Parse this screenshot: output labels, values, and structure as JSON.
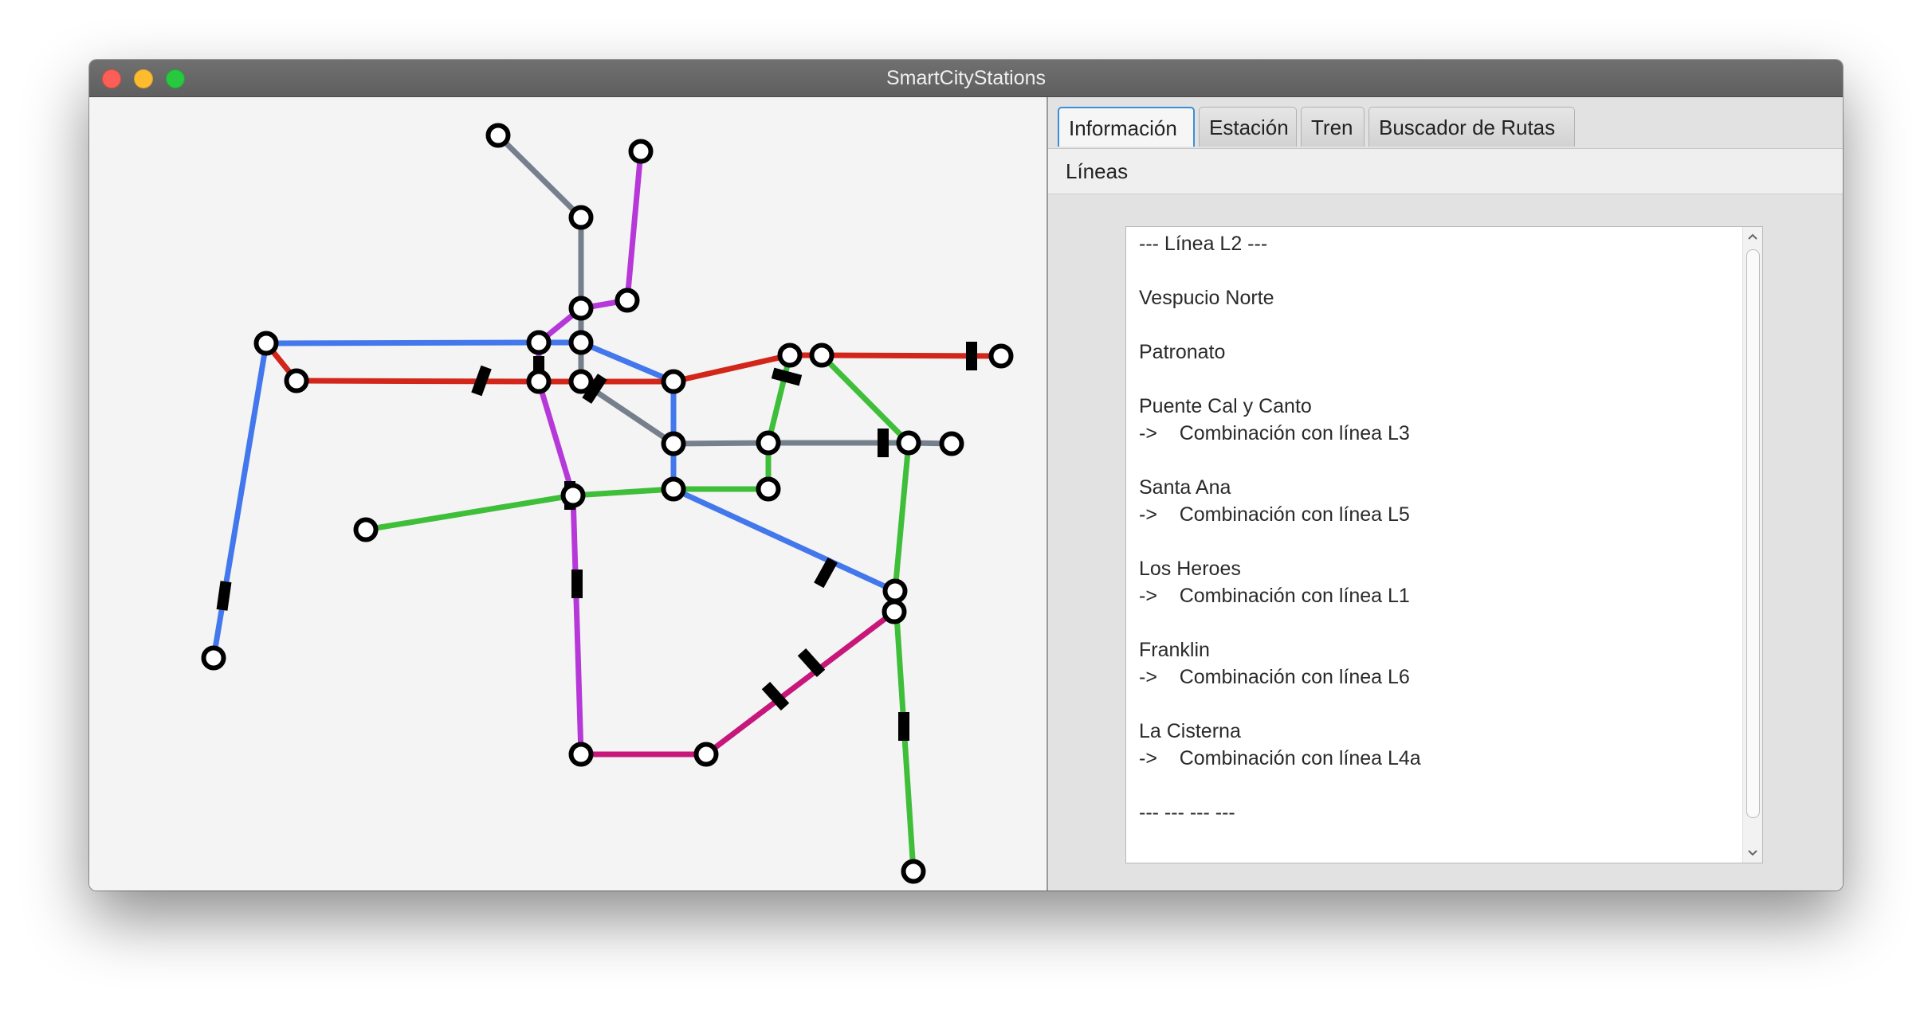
{
  "window": {
    "title": "SmartCityStations"
  },
  "tabs": [
    {
      "label": "Información",
      "active": true
    },
    {
      "label": "Estación",
      "active": false
    },
    {
      "label": "Tren",
      "active": false
    },
    {
      "label": "Buscador de Rutas",
      "active": false
    }
  ],
  "menu": {
    "label": "Líneas"
  },
  "info_text": "--- Línea L2 ---\n\nVespucio Norte\n\nPatronato\n\nPuente Cal y Canto\n->    Combinación con línea L3\n\nSanta Ana\n->    Combinación con línea L5\n\nLos Heroes\n->    Combinación con línea L1\n\nFranklin\n->    Combinación con línea L6\n\nLa Cisterna\n->    Combinación con línea L4a\n\n--- --- --- ---",
  "map": {
    "colors": {
      "blue": "#4378ec",
      "red": "#d2261a",
      "purple": "#b638d8",
      "green": "#3fbe3a",
      "gray": "#76808c",
      "magenta": "#c7177a",
      "station_fill": "#ffffff",
      "station_stroke": "#000000",
      "train": "#000000"
    }
  }
}
